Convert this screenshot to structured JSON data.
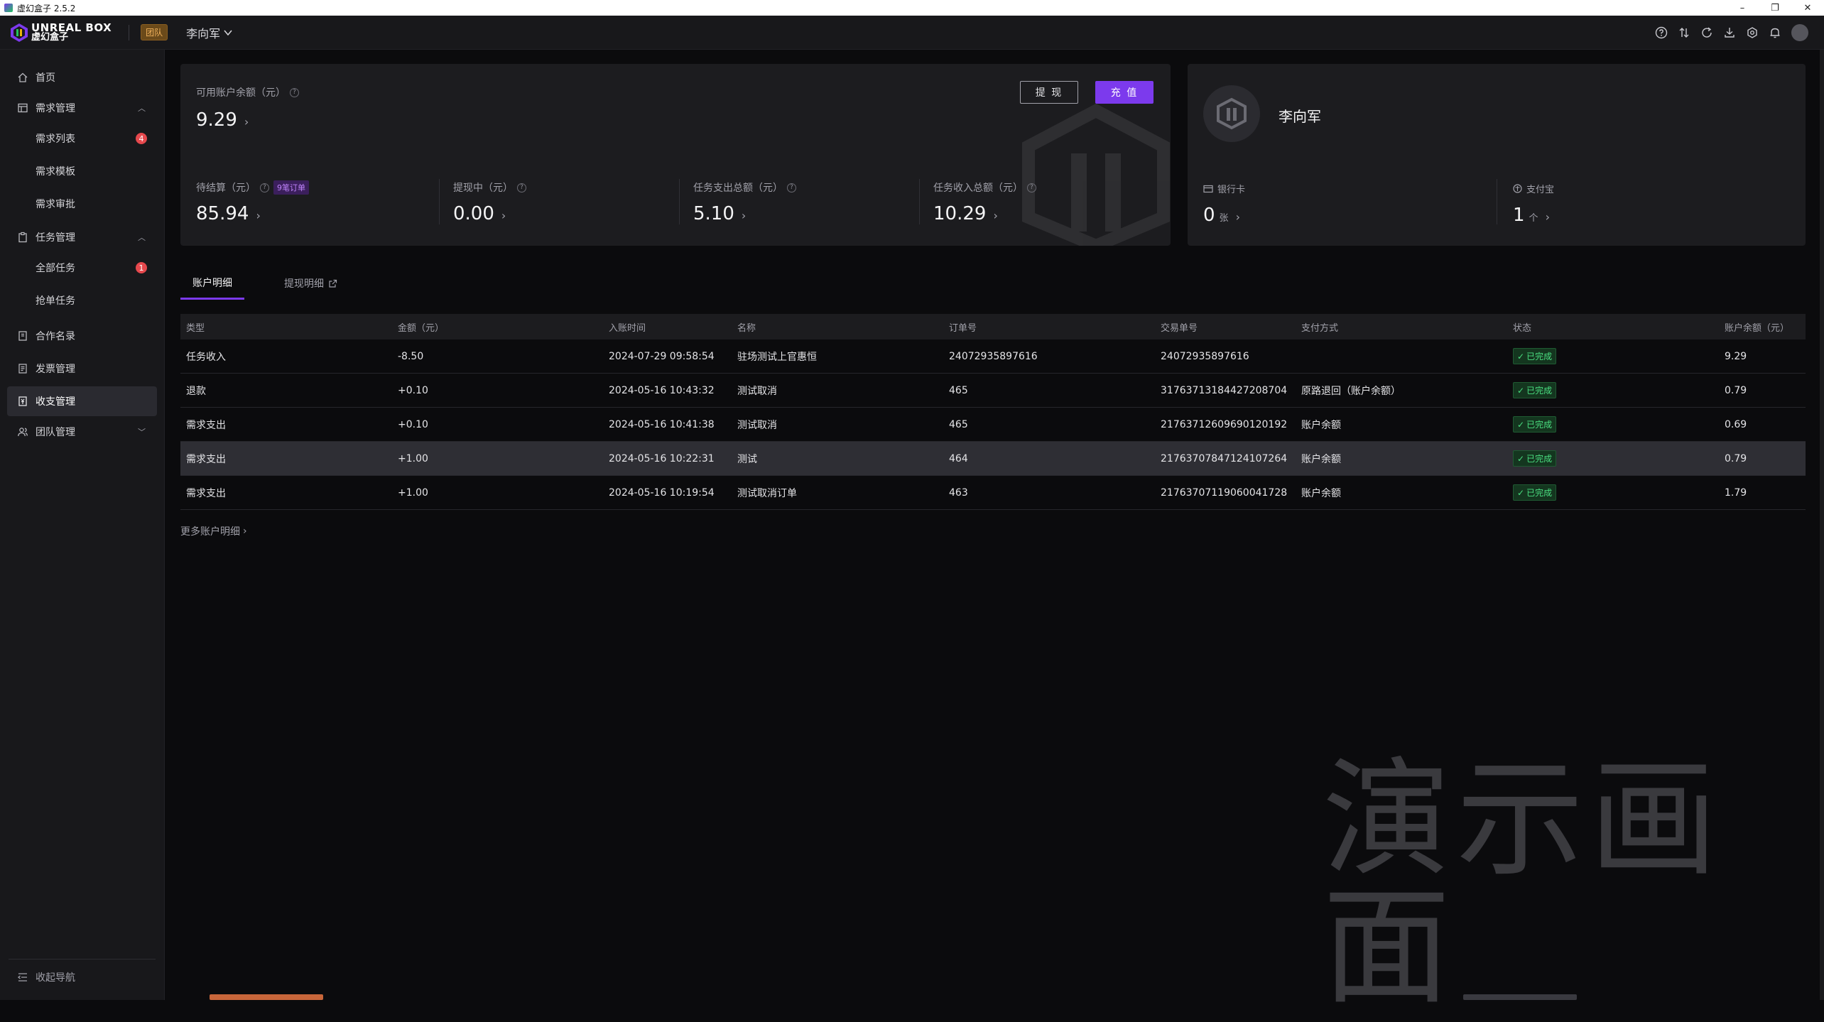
{
  "window": {
    "title": "虚幻盒子 2.5.2",
    "controls": [
      "–",
      "❐",
      "✕"
    ]
  },
  "header": {
    "logo_en": "UNREAL BOX",
    "logo_cn": "虚幻盒子",
    "team_badge": "团队",
    "user_switch": "李向军",
    "icons": [
      "help-icon",
      "sort-icon",
      "refresh-icon",
      "download-icon",
      "settings-icon",
      "bell-icon",
      "avatar"
    ]
  },
  "sidebar": {
    "items": [
      {
        "label": "首页",
        "icon": "home-icon"
      },
      {
        "label": "需求管理",
        "icon": "table-icon",
        "expanded": true
      },
      {
        "label": "需求列表",
        "badge": "4"
      },
      {
        "label": "需求模板"
      },
      {
        "label": "需求审批"
      },
      {
        "label": "任务管理",
        "icon": "clipboard-icon",
        "expanded": true
      },
      {
        "label": "全部任务",
        "badge": "1"
      },
      {
        "label": "抢单任务"
      },
      {
        "label": "合作名录",
        "icon": "book-icon"
      },
      {
        "label": "发票管理",
        "icon": "invoice-icon"
      },
      {
        "label": "收支管理",
        "icon": "finance-icon",
        "active": true
      },
      {
        "label": "团队管理",
        "icon": "team-icon",
        "expanded": false
      }
    ],
    "collapse_label": "收起导航"
  },
  "balance": {
    "available_label": "可用账户余额（元）",
    "available_value": "9.29",
    "withdraw_button": "提 现",
    "recharge_button": "充 值",
    "stats": [
      {
        "label": "待结算（元）",
        "value": "85.94",
        "tag": "9笔订单"
      },
      {
        "label": "提现中（元）",
        "value": "0.00"
      },
      {
        "label": "任务支出总额（元）",
        "value": "5.10"
      },
      {
        "label": "任务收入总额（元）",
        "value": "10.29"
      }
    ]
  },
  "user_card": {
    "name": "李向军",
    "bank_label": "银行卡",
    "bank_value": "0",
    "bank_unit": "张",
    "alipay_label": "支付宝",
    "alipay_value": "1",
    "alipay_unit": "个"
  },
  "tabs": {
    "account_detail": "账户明细",
    "withdraw_detail": "提现明细"
  },
  "table": {
    "headers": [
      "类型",
      "金额（元）",
      "入账时间",
      "名称",
      "订单号",
      "交易单号",
      "支付方式",
      "状态",
      "账户余额（元）"
    ],
    "rows": [
      {
        "type": "任务收入",
        "amount": "-8.50",
        "time": "2024-07-29 09:58:54",
        "name": "驻场测试上官惠恒",
        "order": "24072935897616",
        "trade": "24072935897616",
        "pay": "",
        "status": "已完成",
        "balance": "9.29"
      },
      {
        "type": "退款",
        "amount": "+0.10",
        "time": "2024-05-16 10:43:32",
        "name": "测试取消",
        "order": "465",
        "trade": "31763713184427208704",
        "pay": "原路退回（账户余额）",
        "status": "已完成",
        "balance": "0.79"
      },
      {
        "type": "需求支出",
        "amount": "+0.10",
        "time": "2024-05-16 10:41:38",
        "name": "测试取消",
        "order": "465",
        "trade": "21763712609690120192",
        "pay": "账户余额",
        "status": "已完成",
        "balance": "0.69"
      },
      {
        "type": "需求支出",
        "amount": "+1.00",
        "time": "2024-05-16 10:22:31",
        "name": "测试",
        "order": "464",
        "trade": "21763707847124107264",
        "pay": "账户余额",
        "status": "已完成",
        "balance": "0.79"
      },
      {
        "type": "需求支出",
        "amount": "+1.00",
        "time": "2024-05-16 10:19:54",
        "name": "测试取消订单",
        "order": "463",
        "trade": "21763707119060041728",
        "pay": "账户余额",
        "status": "已完成",
        "balance": "1.79"
      }
    ],
    "highlighted_row": 3
  },
  "more_link": "更多账户明细",
  "watermark": "演示画面",
  "colors": {
    "accent": "#7c3aed",
    "success": "#4ade80",
    "badge": "#e5484d",
    "team_badge": "#f2b25c"
  }
}
